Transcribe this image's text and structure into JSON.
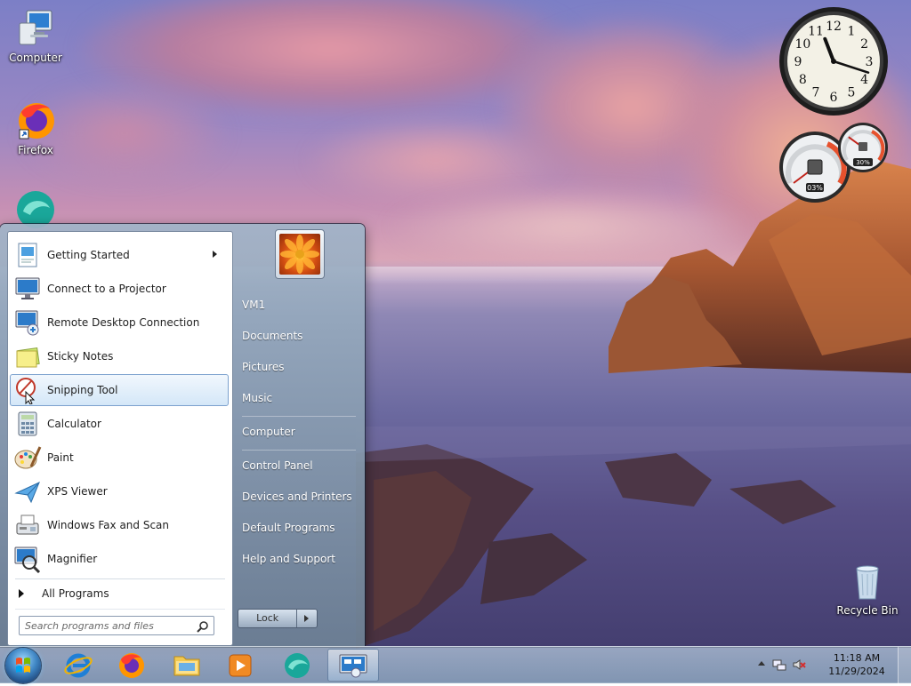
{
  "desktop": {
    "icons": [
      {
        "label": "Computer",
        "icon": "computer-icon"
      },
      {
        "label": "Firefox",
        "icon": "firefox-icon"
      },
      {
        "label": "",
        "icon": "app-icon"
      },
      {
        "label": "Recycle Bin",
        "icon": "recycle-bin-icon"
      }
    ]
  },
  "gadgets": {
    "clock": {
      "numerals": [
        "12",
        "1",
        "2",
        "3",
        "4",
        "5",
        "6",
        "7",
        "8",
        "9",
        "10",
        "11"
      ],
      "time": "11:18"
    },
    "cpu_meter": {
      "cpu_label": "03%",
      "memory_label": "30%",
      "cpu_percent": 3,
      "memory_percent": 30
    }
  },
  "start_menu": {
    "programs": [
      {
        "label": "Getting Started",
        "icon": "getting-started-icon",
        "has_submenu": true
      },
      {
        "label": "Connect to a Projector",
        "icon": "projector-icon"
      },
      {
        "label": "Remote Desktop Connection",
        "icon": "remote-desktop-icon"
      },
      {
        "label": "Sticky Notes",
        "icon": "sticky-notes-icon"
      },
      {
        "label": "Snipping Tool",
        "icon": "snipping-tool-icon",
        "highlighted": true
      },
      {
        "label": "Calculator",
        "icon": "calculator-icon"
      },
      {
        "label": "Paint",
        "icon": "paint-icon"
      },
      {
        "label": "XPS Viewer",
        "icon": "xps-viewer-icon"
      },
      {
        "label": "Windows Fax and Scan",
        "icon": "fax-scan-icon"
      },
      {
        "label": "Magnifier",
        "icon": "magnifier-icon"
      }
    ],
    "all_programs_label": "All Programs",
    "search_placeholder": "Search programs and files",
    "right_links": [
      {
        "label": "VM1"
      },
      {
        "label": "Documents"
      },
      {
        "label": "Pictures"
      },
      {
        "label": "Music"
      },
      {
        "label": "Computer"
      },
      {
        "label": "Control Panel"
      },
      {
        "label": "Devices and Printers"
      },
      {
        "label": "Default Programs"
      },
      {
        "label": "Help and Support"
      }
    ],
    "lock_label": "Lock"
  },
  "taskbar": {
    "pinned": [
      {
        "icon": "start-orb-icon"
      },
      {
        "icon": "internet-explorer-icon"
      },
      {
        "icon": "firefox-icon"
      },
      {
        "icon": "windows-explorer-icon"
      },
      {
        "icon": "media-player-icon"
      },
      {
        "icon": "app-icon"
      },
      {
        "icon": "remote-desktop-icon",
        "active": true
      }
    ],
    "clock_time": "11:18 AM",
    "clock_date": "11/29/2024"
  },
  "colors": {
    "highlight_bg": "#d4e7f8",
    "highlight_border": "#7da2ce",
    "start_menu_glass": "#8ea3b8"
  }
}
